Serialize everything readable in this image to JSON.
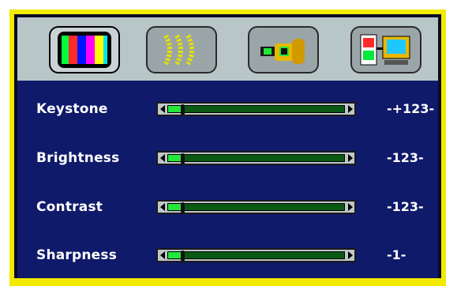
{
  "osd": {
    "tabs": [
      {
        "name": "color-bars-icon",
        "active": true
      },
      {
        "name": "waves-icon",
        "active": false
      },
      {
        "name": "wrench-icon",
        "active": false
      },
      {
        "name": "network-monitor-icon",
        "active": false
      }
    ],
    "rows": [
      {
        "label": "Keystone",
        "value": "-+123-",
        "level": 0.08
      },
      {
        "label": "Brightness",
        "value": "-123-",
        "level": 0.08
      },
      {
        "label": "Contrast",
        "value": "-123-",
        "level": 0.08
      },
      {
        "label": "Sharpness",
        "value": "-1-",
        "level": 0.08
      }
    ]
  },
  "colors": {
    "frame": "#f2ea00",
    "panel": "#101a6a",
    "track": "#0a5a14",
    "fill": "#22e83a"
  }
}
